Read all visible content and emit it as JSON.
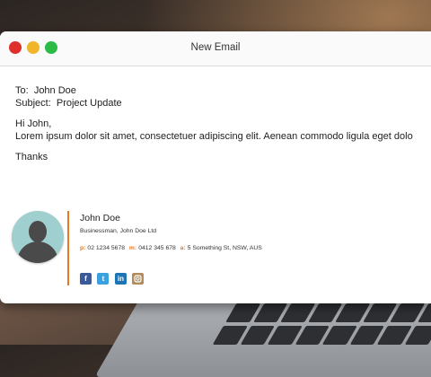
{
  "window": {
    "title": "New Email"
  },
  "email": {
    "to_label": "To:",
    "to_value": "John Doe",
    "subject_label": "Subject:",
    "subject_value": "Project Update",
    "greeting": "Hi John,",
    "body": "Lorem ipsum dolor sit amet, consectetuer adipiscing elit. Aenean commodo ligula eget dolo",
    "closing": "Thanks"
  },
  "signature": {
    "name": "John Doe",
    "role": "Businessman, John Doe Ltd",
    "phone_key": "p:",
    "phone": "02 1234 5678",
    "mobile_key": "m:",
    "mobile": "0412 345 678",
    "address_key": "a:",
    "address": "5 Something St, NSW, AUS",
    "socials": [
      "facebook-icon",
      "twitter-icon",
      "linkedin-icon",
      "instagram-icon"
    ],
    "accent_color": "#e8791f"
  }
}
